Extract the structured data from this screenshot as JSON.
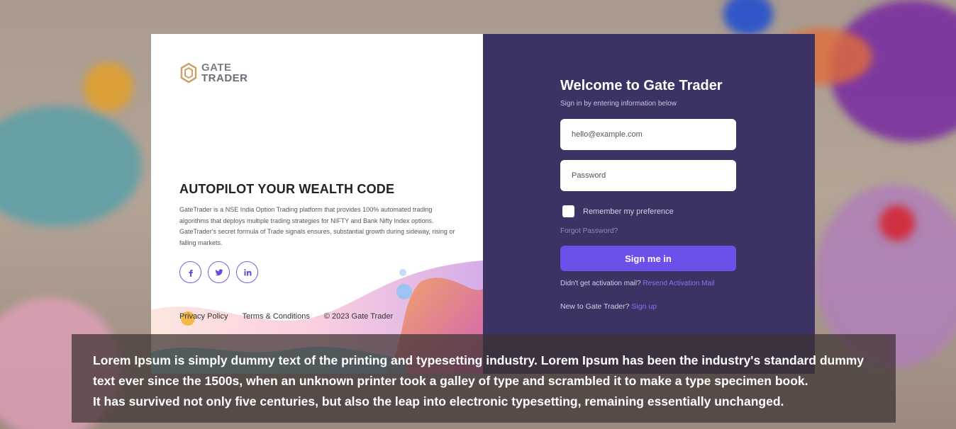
{
  "logo": {
    "line1": "GATE",
    "line2": "TRADER",
    "icon": "hexagon-logo-icon"
  },
  "hero": {
    "headline": "AUTOPILOT YOUR WEALTH CODE",
    "description": "GateTrader is a NSE India Option Trading platform that provides 100% automated trading algorithms that deploys multiple trading strategies for NIFTY and Bank Nifty Index options. GateTrader's secret formula of Trade signals ensures, substantial growth during sideway, rising or falling markets."
  },
  "socials": [
    {
      "icon": "facebook-icon",
      "glyph": "f"
    },
    {
      "icon": "twitter-icon",
      "glyph": "t"
    },
    {
      "icon": "linkedin-icon",
      "glyph": "in"
    }
  ],
  "footer": {
    "privacy": "Privacy Policy",
    "terms": "Terms & Conditions",
    "copyright": "© 2023 Gate Trader"
  },
  "login": {
    "title": "Welcome to Gate Trader",
    "subtitle": "Sign in by entering information below",
    "email_placeholder": "hello@example.com",
    "password_placeholder": "Password",
    "remember_label": "Remember my preference",
    "forgot_label": "Forgot Password?",
    "signin_label": "Sign me in",
    "activation_text": "Didn't get activation mail?",
    "activation_link": "Resend Activation Mail",
    "new_user_text": "New to Gate Trader?",
    "signup_link": "Sign up"
  },
  "caption": {
    "line1": "Lorem Ipsum is simply dummy text of the printing and typesetting industry. Lorem Ipsum has been the industry's standard dummy text ever since the 1500s, when an unknown printer took a galley of type and scrambled it to make a type specimen book.",
    "line2": "It has survived not only five centuries, but also the leap into electronic typesetting, remaining essentially unchanged."
  },
  "colors": {
    "panel": "#3d3264",
    "accent": "#6d4fe9",
    "link": "#8d70f2"
  }
}
